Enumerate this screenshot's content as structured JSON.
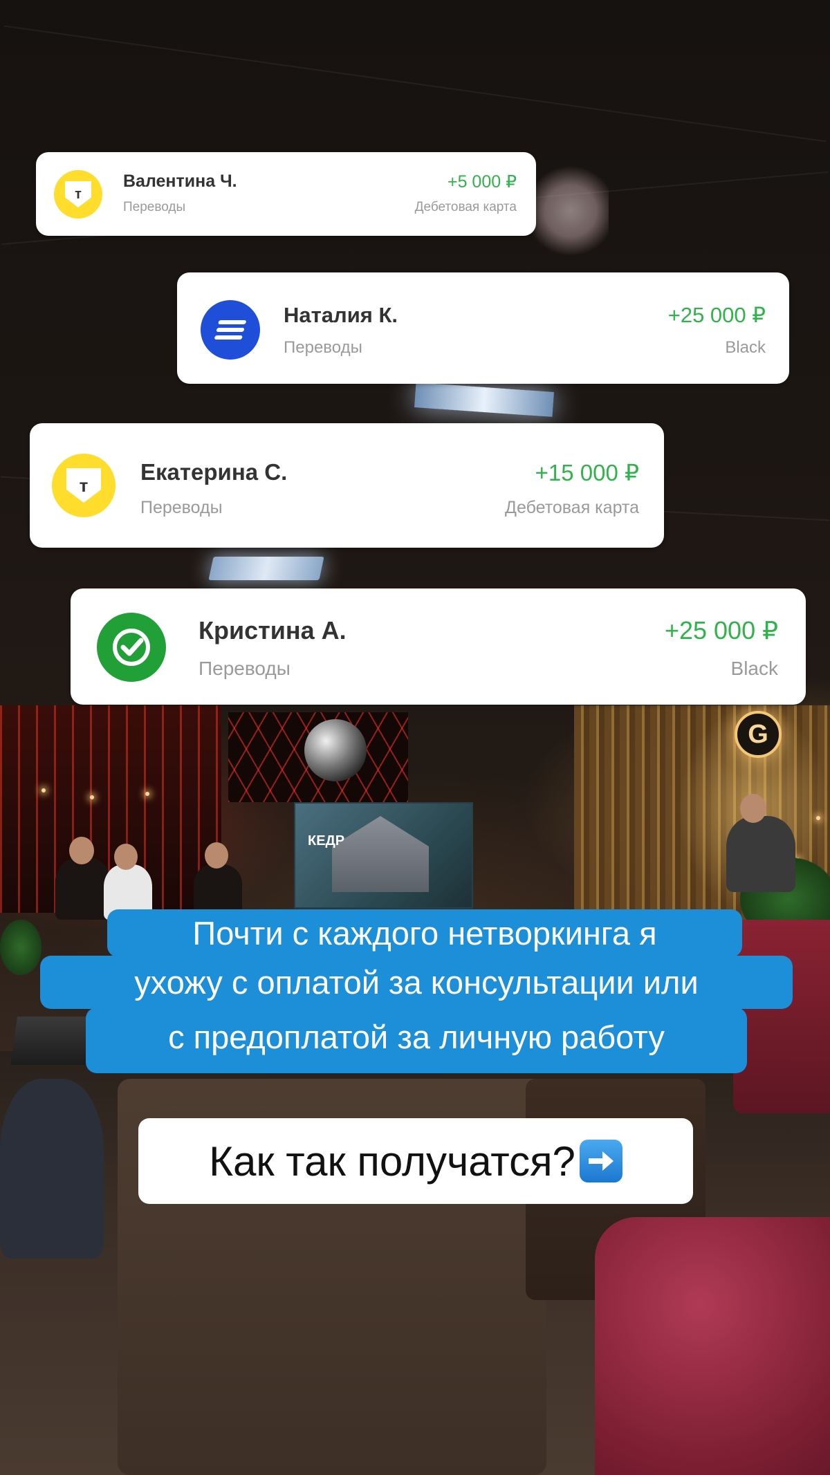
{
  "transfers": [
    {
      "name": "Валентина Ч.",
      "category": "Переводы",
      "amount": "+5 000 ₽",
      "account": "Дебетовая карта",
      "bank_icon": "tbank-logo-icon",
      "logo_letter": "т"
    },
    {
      "name": "Наталия К.",
      "category": "Переводы",
      "amount": "+25 000 ₽",
      "account": "Black",
      "bank_icon": "blue-bank-logo-icon"
    },
    {
      "name": "Екатерина С.",
      "category": "Переводы",
      "amount": "+15 000 ₽",
      "account": "Дебетовая карта",
      "bank_icon": "tbank-logo-icon",
      "logo_letter": "т"
    },
    {
      "name": "Кристина А.",
      "category": "Переводы",
      "amount": "+25 000 ₽",
      "account": "Black",
      "bank_icon": "sber-logo-icon"
    }
  ],
  "caption": {
    "lines": [
      "Почти с каждого нетворкинга я",
      "ухожу с оплатой за консультации или",
      "с предоплатой за личную работу"
    ],
    "question": "Как так получатся?",
    "question_icon": "right-arrow-icon"
  },
  "background": {
    "logo_letter": "G",
    "banner_text": "КЕДР"
  },
  "colors": {
    "amount_green": "#2fb34a",
    "caption_blue": "#1d8fd8",
    "tbank_yellow": "#ffdd2d",
    "sber_green": "#21a038",
    "blue_bank": "#1f4fd8"
  }
}
